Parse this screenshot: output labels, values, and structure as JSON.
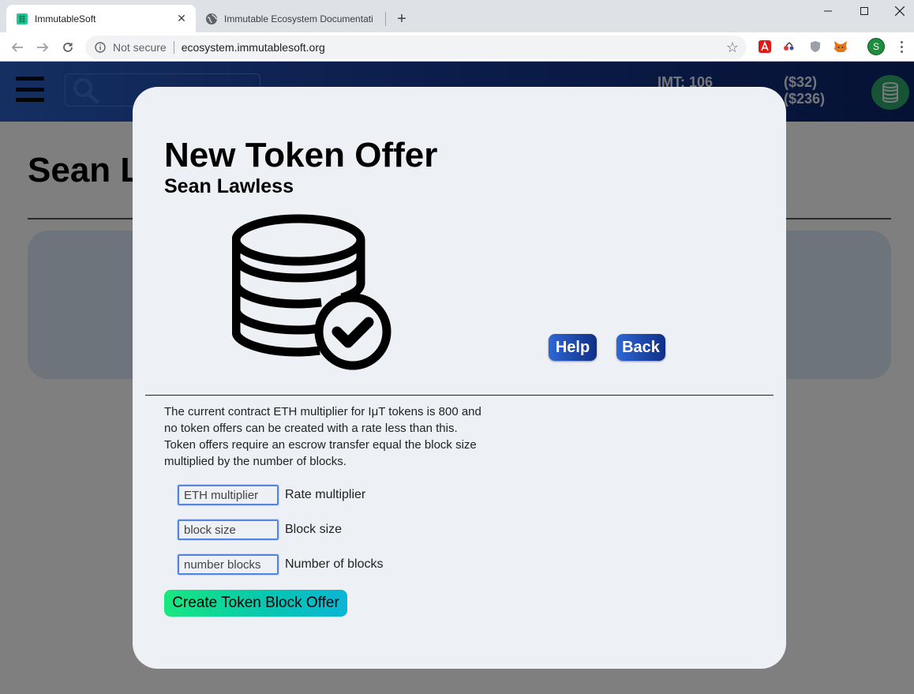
{
  "browser": {
    "tabs": [
      {
        "title": "ImmutableSoft",
        "active": true
      },
      {
        "title": "Immutable Ecosystem Documentati",
        "active": false
      }
    ],
    "security_label": "Not secure",
    "url": "ecosystem.immutablesoft.org",
    "profile_initial": "S"
  },
  "header": {
    "imt_balance": "IMT: 106",
    "balance_1": "($32)",
    "balance_2": "($236)"
  },
  "background": {
    "page_title": "Sean L"
  },
  "modal": {
    "title": "New Token Offer",
    "subtitle": "Sean Lawless",
    "help_label": "Help",
    "back_label": "Back",
    "description": "The current contract ETH multiplier for IμT tokens is 800 and no token offers can be created with a rate less than this. Token offers require an escrow transfer equal the block size multiplied by the number of blocks.",
    "fields": [
      {
        "placeholder": "ETH multiplier",
        "label": "Rate multiplier"
      },
      {
        "placeholder": "block size",
        "label": "Block size"
      },
      {
        "placeholder": "number blocks",
        "label": "Number of blocks"
      }
    ],
    "create_label": "Create Token Block Offer"
  }
}
